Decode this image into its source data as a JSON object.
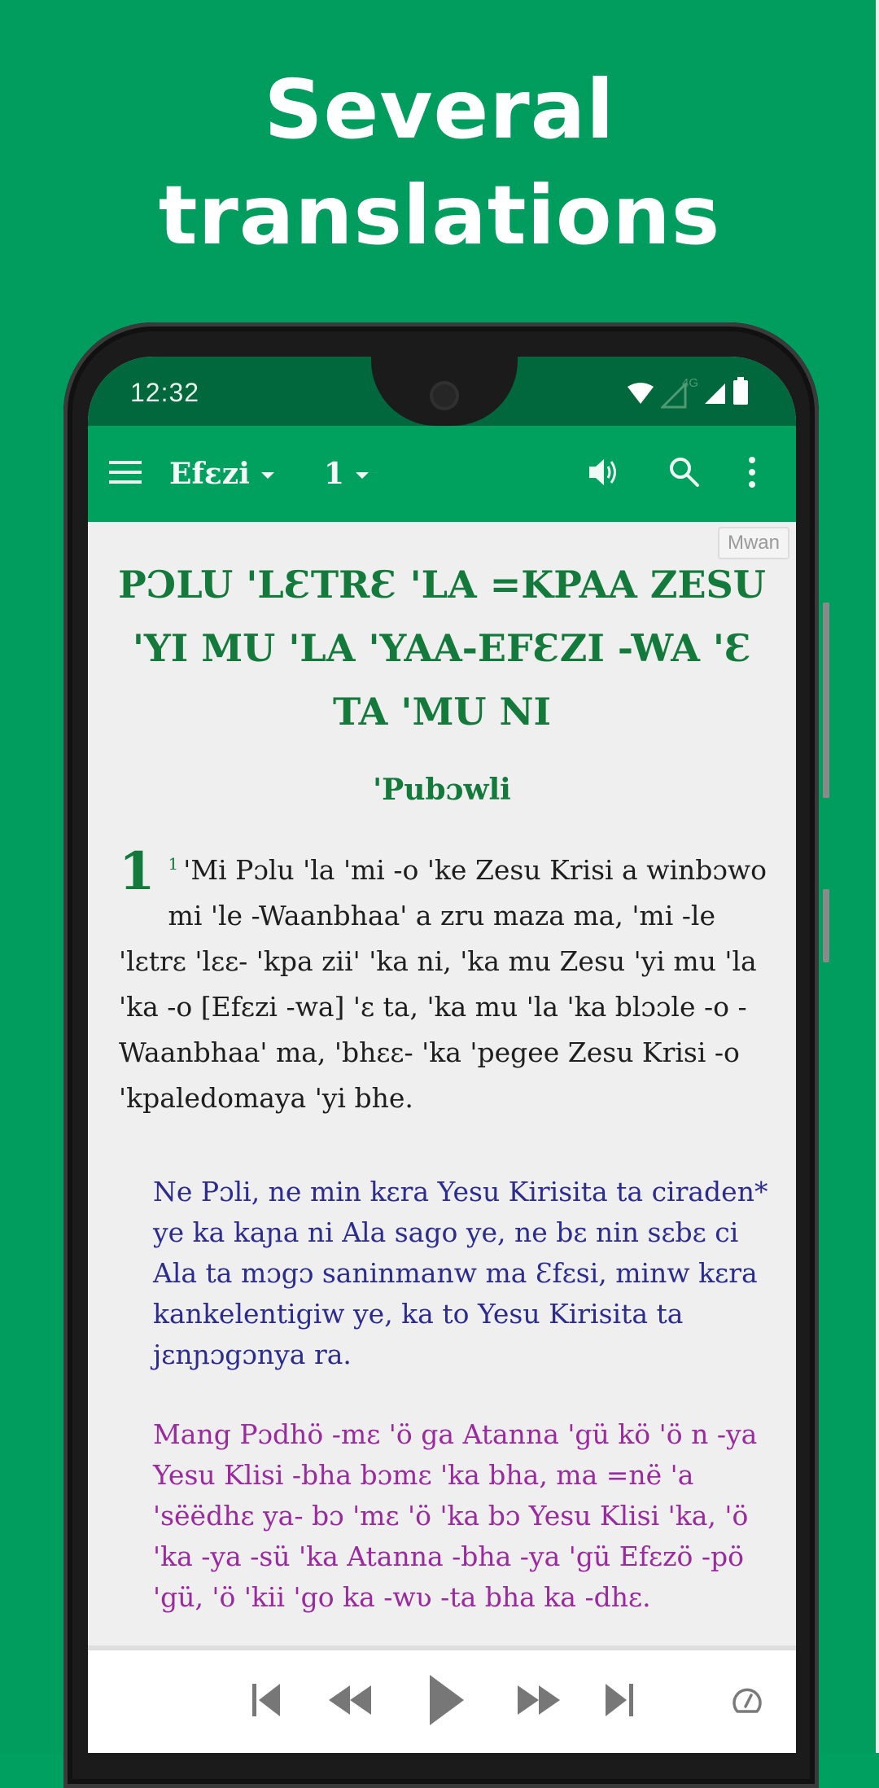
{
  "promo": {
    "headline_line1": "Several",
    "headline_line2": "translations",
    "background_color": "#009d5e"
  },
  "status_bar": {
    "time": "12:32",
    "network_label": "4G",
    "icons": [
      "wifi-icon",
      "cell-signal-empty-icon",
      "cell-signal-icon",
      "battery-icon"
    ]
  },
  "toolbar": {
    "menu_icon": "hamburger-menu-icon",
    "book": "Efɛzi",
    "chapter": "1",
    "audio_icon": "speaker-icon",
    "search_icon": "search-icon",
    "more_icon": "more-vertical-icon",
    "color": "#00a05e"
  },
  "content": {
    "language_tag": "Mwan",
    "book_title": "PƆLU 'LƐTRƐ 'LA =KPAA ZESU 'YI MU 'LA 'YAA-EFƐZI -WA 'Ɛ TA 'MU NI",
    "section_heading": "'Pubɔwli",
    "chapter_number": "1",
    "verse_number": "1",
    "verse_text": "'Mi Pɔlu 'la 'mi -o 'ke Zesu Krisi a winbɔwo mi 'le -Waanbhaa' a zru maza ma, 'mi -le 'lɛtrɛ 'lɛɛ- 'kpa zii' 'ka ni, 'ka mu Zesu 'yi mu 'la 'ka -o [Efɛzi -wa] 'ɛ ta, 'ka mu 'la 'ka blɔɔle -o -Waanbhaa' ma, 'bhɛɛ- 'ka 'pegee Zesu Krisi -o 'kpaledomaya 'yi bhe.",
    "parallel_translations": [
      {
        "text": "Ne Pɔli, ne min kɛra Yesu Kirisita ta ciraden* ye ka kaɲa ni Ala sago ye, ne bɛ nin sɛbɛ ci Ala ta mɔgɔ saninmanw ma Ɛfɛsi, minw kɛra kankelentigiw ye, ka to Yesu Kirisita ta jɛnɲɔgɔnya ra.",
        "color": "#2c2c90"
      },
      {
        "text": "Mang Pɔdhö -mɛ 'ö ga Atanna 'gü kö 'ö n -ya Yesu Klisi -bha bɔmɛ 'ka bha, ma =në 'a 'sëëdhɛ ya- bɔ 'mɛ 'ö 'ka bɔ Yesu Klisi 'ka, 'ö 'ka -ya -sü 'ka Atanna -bha -ya 'gü Efɛzö -pö 'gü, 'ö 'kii 'go ka -wʋ -ta bha ka -dhɛ.",
        "color": "#9a2a9e"
      }
    ]
  },
  "player": {
    "buttons": [
      {
        "name": "skip-to-start-button",
        "icon": "skip-previous-icon"
      },
      {
        "name": "rewind-button",
        "icon": "rewind-icon"
      },
      {
        "name": "play-button",
        "icon": "play-icon"
      },
      {
        "name": "fast-forward-button",
        "icon": "fast-forward-icon"
      },
      {
        "name": "skip-to-end-button",
        "icon": "skip-next-icon"
      },
      {
        "name": "playback-speed-button",
        "icon": "speedometer-icon"
      }
    ]
  }
}
